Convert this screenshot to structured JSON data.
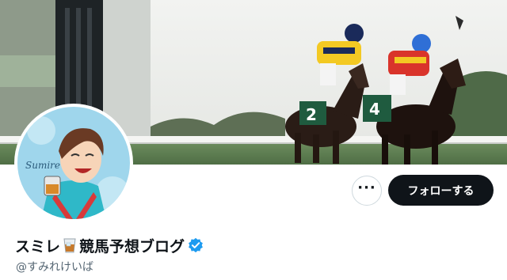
{
  "profile": {
    "name_part1": "スミレ",
    "name_part2": "競馬予想ブログ",
    "handle": "@すみれけいば",
    "verified": true,
    "avatar_signature": "Sumire"
  },
  "banner": {
    "description_icon": "horse-racing-photo",
    "saddle_numbers": [
      "2",
      "4"
    ]
  },
  "actions": {
    "more_label": "···",
    "follow_label": "フォローする"
  },
  "colors": {
    "follow_bg": "#0f1419",
    "verified_blue": "#1d9bf0",
    "handle_gray": "#536471"
  },
  "icons": {
    "more": "more-horizontal-icon",
    "verified": "verified-badge-icon",
    "drink": "whisky-glass-icon"
  }
}
